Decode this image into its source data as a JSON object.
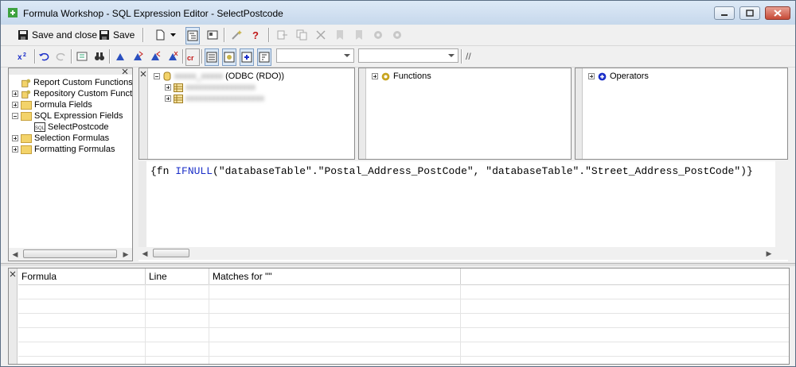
{
  "window": {
    "title": "Formula Workshop - SQL Expression Editor - SelectPostcode"
  },
  "toolbar": {
    "save_close_label": "Save and close",
    "save_label": "Save",
    "comment_label": "//"
  },
  "workshop_tree": {
    "items": [
      {
        "label": "Report Custom Functions"
      },
      {
        "label": "Repository Custom Functi"
      },
      {
        "label": "Formula Fields"
      },
      {
        "label": "SQL Expression Fields"
      },
      {
        "label": "SelectPostcode"
      },
      {
        "label": "Selection Formulas"
      },
      {
        "label": "Formatting Formulas"
      }
    ]
  },
  "fields_tree": {
    "datasource_suffix": "(ODBC (RDO))"
  },
  "functions_tree": {
    "label": "Functions"
  },
  "operators_tree": {
    "label": "Operators"
  },
  "editor": {
    "p1": "{fn ",
    "kw": "IFNULL",
    "p2": "(\"databaseTable\".\"Postal_Address_PostCode\", \"databaseTable\".\"Street_Address_PostCode\")}"
  },
  "results": {
    "columns": [
      "Formula",
      "Line",
      "Matches for \"\""
    ]
  }
}
